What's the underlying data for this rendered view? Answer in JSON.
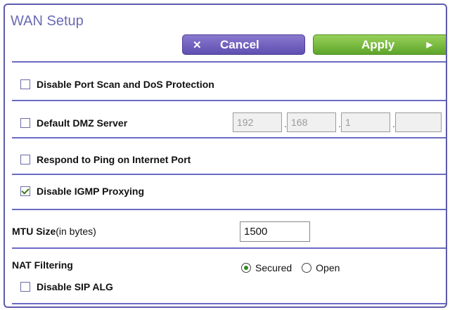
{
  "header": {
    "title": "WAN Setup"
  },
  "buttons": {
    "cancel_label": "Cancel",
    "apply_label": "Apply"
  },
  "settings": {
    "port_scan_label": "Disable Port Scan and DoS Protection",
    "port_scan_checked": false,
    "dmz_label": "Default DMZ Server",
    "dmz_checked": false,
    "dmz_ip": [
      "192",
      "168",
      "1",
      ""
    ],
    "ping_label": "Respond to Ping on Internet Port",
    "ping_checked": false,
    "igmp_label": "Disable IGMP Proxying",
    "igmp_checked": true,
    "mtu_label": "MTU Size",
    "mtu_unit": "(in bytes)",
    "mtu_value": "1500",
    "nat_label": "NAT Filtering",
    "nat_options": [
      "Secured",
      "Open"
    ],
    "nat_selected": "Secured",
    "sip_label": "Disable SIP ALG",
    "sip_checked": false
  },
  "colors": {
    "accent": "#6a6bc2",
    "cancel": "#7464c0",
    "apply": "#78bb3f"
  }
}
